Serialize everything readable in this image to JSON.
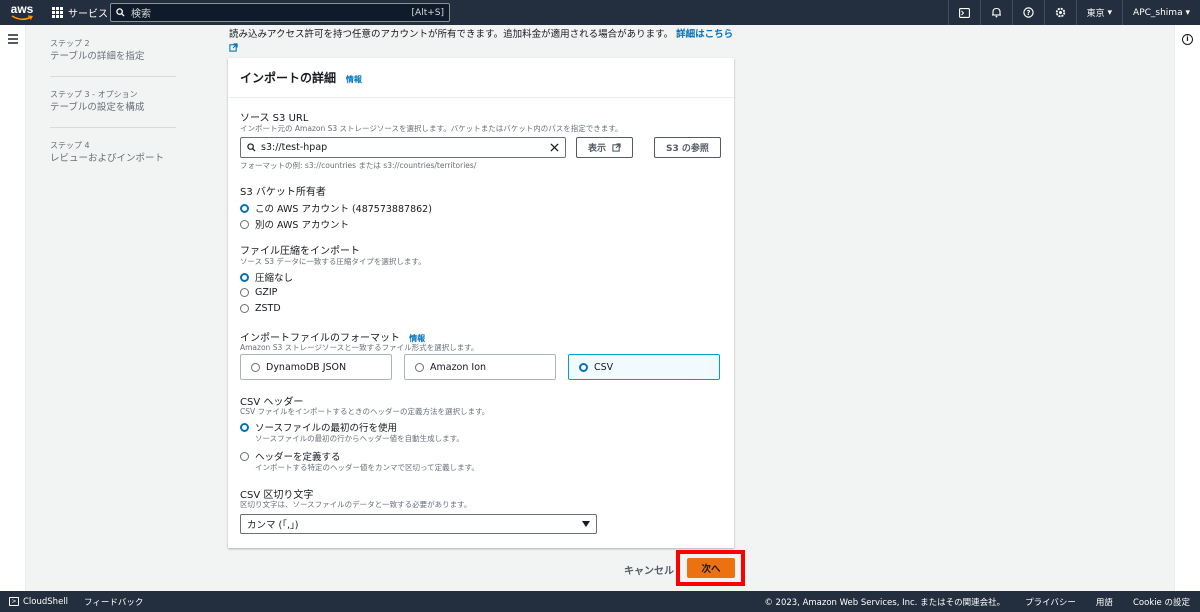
{
  "topnav": {
    "logo_text": "aws",
    "services_label": "サービス",
    "search_placeholder": "検索",
    "search_shortcut": "[Alt+S]",
    "region": "東京",
    "account": "APC_shima"
  },
  "steps": [
    {
      "kicker": "ステップ 2",
      "label": "テーブルの詳細を指定"
    },
    {
      "kicker": "ステップ 3 - オプション",
      "label": "テーブルの設定を構成"
    },
    {
      "kicker": "ステップ 4",
      "label": "レビューおよびインポート"
    }
  ],
  "intro": {
    "text": "読み込みアクセス許可を持つ任意のアカウントが所有できます。追加料金が適用される場合があります。",
    "link": "詳細はこちら"
  },
  "panel": {
    "title": "インポートの詳細",
    "info": "情報",
    "s3_url": {
      "label": "ソース S3 URL",
      "description": "インポート元の Amazon S3 ストレージソースを選択します。バケットまたはバケット内のパスを指定できます。",
      "value": "s3://test-hpap",
      "hint": "フォーマットの例: s3://countries または s3://countries/territories/",
      "view_button": "表示",
      "browse_button": "S3 の参照"
    },
    "bucket_owner": {
      "label": "S3 バケット所有者",
      "options": [
        "この AWS アカウント (487573887862)",
        "別の AWS アカウント"
      ],
      "selected": 0
    },
    "compression": {
      "label": "ファイル圧縮をインポート",
      "description": "ソース S3 データに一致する圧縮タイプを選択します。",
      "options": [
        "圧縮なし",
        "GZIP",
        "ZSTD"
      ],
      "selected": 0
    },
    "file_format": {
      "label": "インポートファイルのフォーマット",
      "info": "情報",
      "description": "Amazon S3 ストレージソースと一致するファイル形式を選択します。",
      "options": [
        "DynamoDB JSON",
        "Amazon Ion",
        "CSV"
      ],
      "selected": 2
    },
    "csv_header": {
      "label": "CSV ヘッダー",
      "description": "CSV ファイルをインポートするときのヘッダーの定義方法を選択します。",
      "options": [
        {
          "label": "ソースファイルの最初の行を使用",
          "sub": "ソースファイルの最初の行からヘッダー値を自動生成します。"
        },
        {
          "label": "ヘッダーを定義する",
          "sub": "インポートする特定のヘッダー値をカンマで区切って定義します。"
        }
      ],
      "selected": 0
    },
    "csv_delimiter": {
      "label": "CSV 区切り文字",
      "description": "区切り文字は、ソースファイルのデータと一致する必要があります。",
      "value": "カンマ (「,」)"
    }
  },
  "actions": {
    "cancel": "キャンセル",
    "next": "次へ",
    "highlight_color": "#ff0000",
    "primary_color": "#ec7211"
  },
  "footer": {
    "cloudshell": "CloudShell",
    "feedback": "フィードバック",
    "copyright": "© 2023, Amazon Web Services, Inc. またはその関連会社。",
    "privacy": "プライバシー",
    "terms": "用語",
    "cookie": "Cookie の設定"
  }
}
